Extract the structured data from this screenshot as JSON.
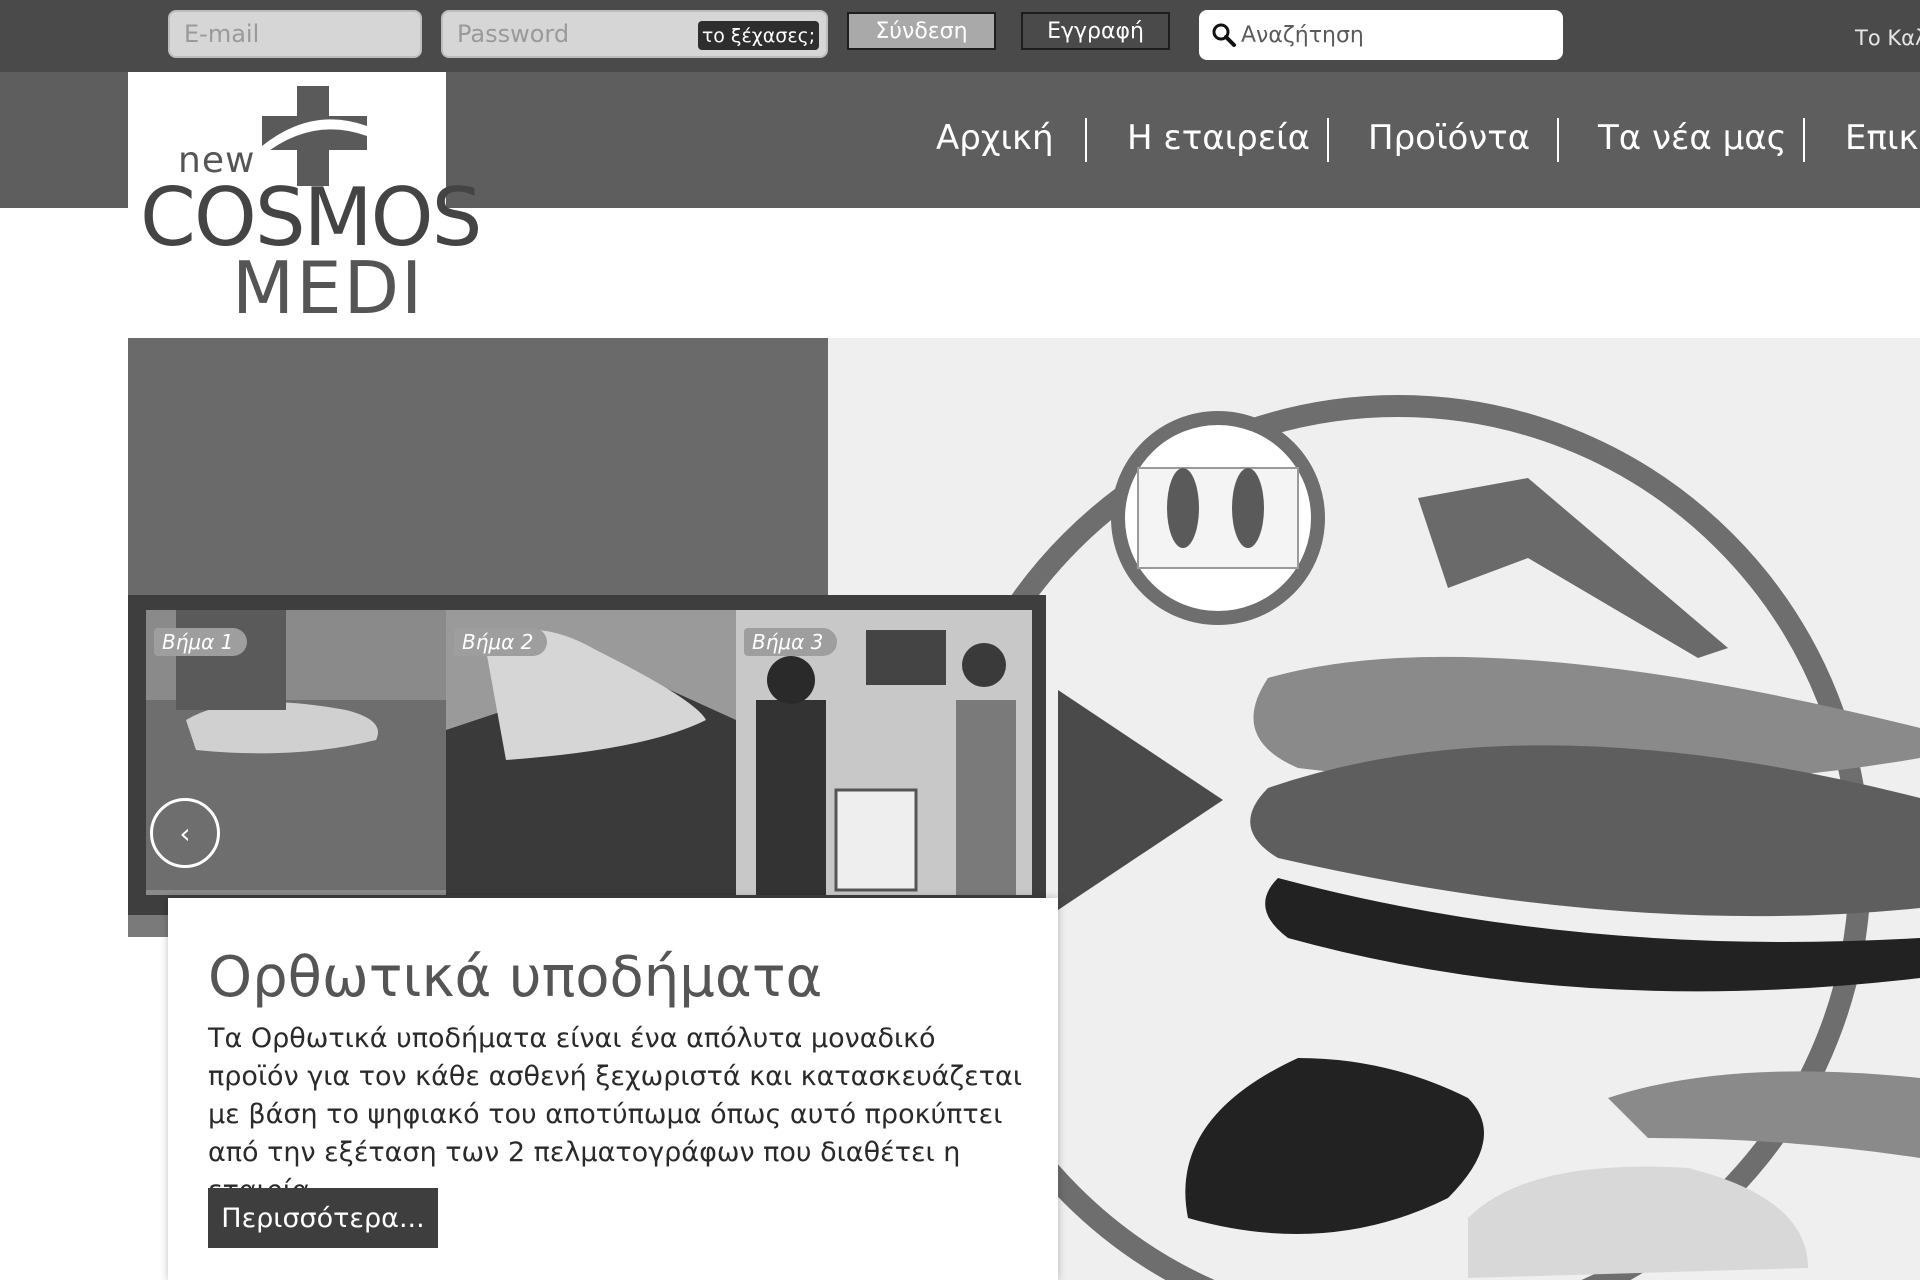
{
  "topbar": {
    "email_placeholder": "E-mail",
    "password_placeholder": "Password",
    "forgot_label": "το ξέχασες;",
    "login_label": "Σύνδεση",
    "register_label": "Εγγραφή",
    "search_placeholder": "Αναζήτηση",
    "right_text": "Το Καλ"
  },
  "nav": {
    "items": [
      "Αρχική",
      "Η εταιρεία",
      "Προϊόντα",
      "Τα νέα μας",
      "Επικο"
    ]
  },
  "logo": {
    "line1": "new",
    "line2": "COSMOS",
    "line3": "MEDI"
  },
  "slider": {
    "steps": [
      "Βήμα 1",
      "Βήμα 2",
      "Βήμα 3"
    ],
    "prev_icon": "chevron-left-icon",
    "title": "Ορθωτικά υποδήματα",
    "text": "Τα Ορθωτικά υποδήματα είναι ένα απόλυτα μοναδικό προϊόν για τον κάθε ασθενή ξεχωριστά και κατασκευάζεται με βάση το ψηφιακό του αποτύπωμα όπως αυτό προκύπτει από την εξέταση των 2 πελματογράφων που διαθέτει η εταιρία.",
    "more_label": "Περισσότερα..."
  },
  "colors": {
    "topbar": "#4a4a4a",
    "nav": "#5e5e5e",
    "button_dark": "#3e3e3e"
  }
}
